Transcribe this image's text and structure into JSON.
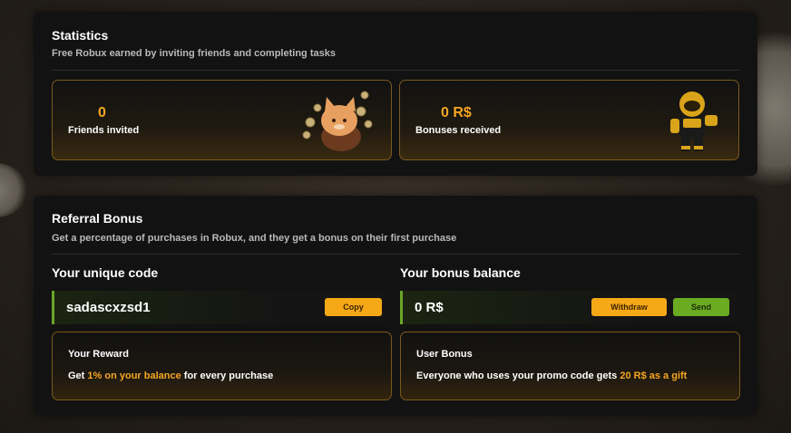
{
  "statistics": {
    "title": "Statistics",
    "subtitle": "Free Robux earned by inviting friends and completing tasks",
    "friends": {
      "value": "0",
      "label": "Friends invited",
      "icon": "cat-coins-icon"
    },
    "bonuses": {
      "value": "0 R$",
      "label": "Bonuses received",
      "icon": "gold-robot-icon"
    }
  },
  "referral": {
    "title": "Referral Bonus",
    "subtitle": "Get a percentage of purchases in Robux, and they get a bonus on their first purchase",
    "code": {
      "heading": "Your unique code",
      "value": "sadascxzsd1",
      "copy_label": "Copy"
    },
    "balance": {
      "heading": "Your bonus balance",
      "value": "0 R$",
      "withdraw_label": "Withdraw",
      "send_label": "Send"
    },
    "reward": {
      "title": "Your Reward",
      "text_before": "Get ",
      "text_highlight": "1% on your balance",
      "text_after": " for every purchase"
    },
    "user_bonus": {
      "title": "User Bonus",
      "text_before": "Everyone who uses your promo code gets ",
      "text_highlight": "20 R$ as a gift"
    }
  },
  "colors": {
    "accent": "#f5a623",
    "green": "#6aab21",
    "panel": "#121212",
    "card_border": "#7a5a1c"
  }
}
